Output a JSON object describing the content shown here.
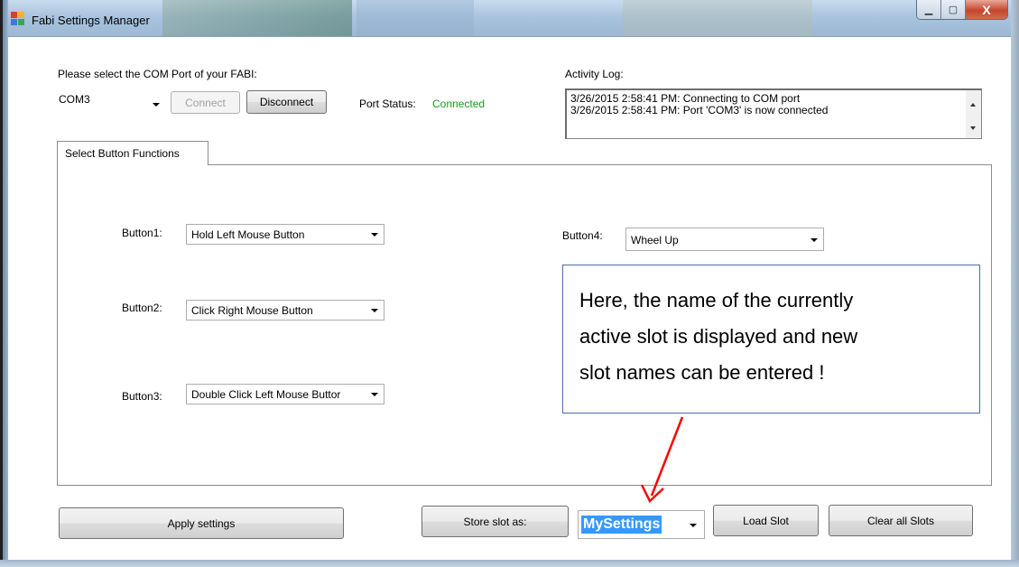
{
  "window": {
    "title": "Fabi Settings Manager",
    "controls": {
      "minimize": "▁",
      "maximize": "▢",
      "close": "X"
    }
  },
  "connection": {
    "prompt": "Please select the COM Port of your FABI:",
    "com_port": "COM3",
    "connect_label": "Connect",
    "disconnect_label": "Disconnect",
    "port_status_label": "Port Status:",
    "port_status_value": "Connected",
    "status_color": "#1a9a1a"
  },
  "activity_log": {
    "label": "Activity Log:",
    "lines": [
      "3/26/2015 2:58:41 PM: Connecting to COM port",
      "3/26/2015 2:58:41 PM: Port 'COM3' is now connected"
    ]
  },
  "tabs": [
    {
      "label": "Select Button Functions",
      "active": true
    }
  ],
  "buttons": [
    {
      "label": "Button1:",
      "value": "Hold Left Mouse Button"
    },
    {
      "label": "Button2:",
      "value": "Click Right Mouse Button"
    },
    {
      "label": "Button3:",
      "value": "Double Click Left Mouse Buttor"
    },
    {
      "label": "Button4:",
      "value": "Wheel Up"
    }
  ],
  "annotation": {
    "lines": [
      "Here, the name of the currently",
      "active slot is displayed and new",
      "slot names can be entered !"
    ],
    "arrow_color": "#ff0000"
  },
  "footer": {
    "apply_label": "Apply settings",
    "store_label": "Store slot as:",
    "slot_name": "MySettings",
    "load_label": "Load Slot",
    "clear_label": "Clear all Slots"
  },
  "icons": {
    "app": "app-window-icon",
    "dropdown": "chevron-down-icon",
    "scroll_up": "scroll-up-icon",
    "scroll_down": "scroll-down-icon"
  },
  "colors": {
    "titlebar": "#a9c4de",
    "selection": "#3399ff",
    "callout_border": "#4a6ea9"
  }
}
